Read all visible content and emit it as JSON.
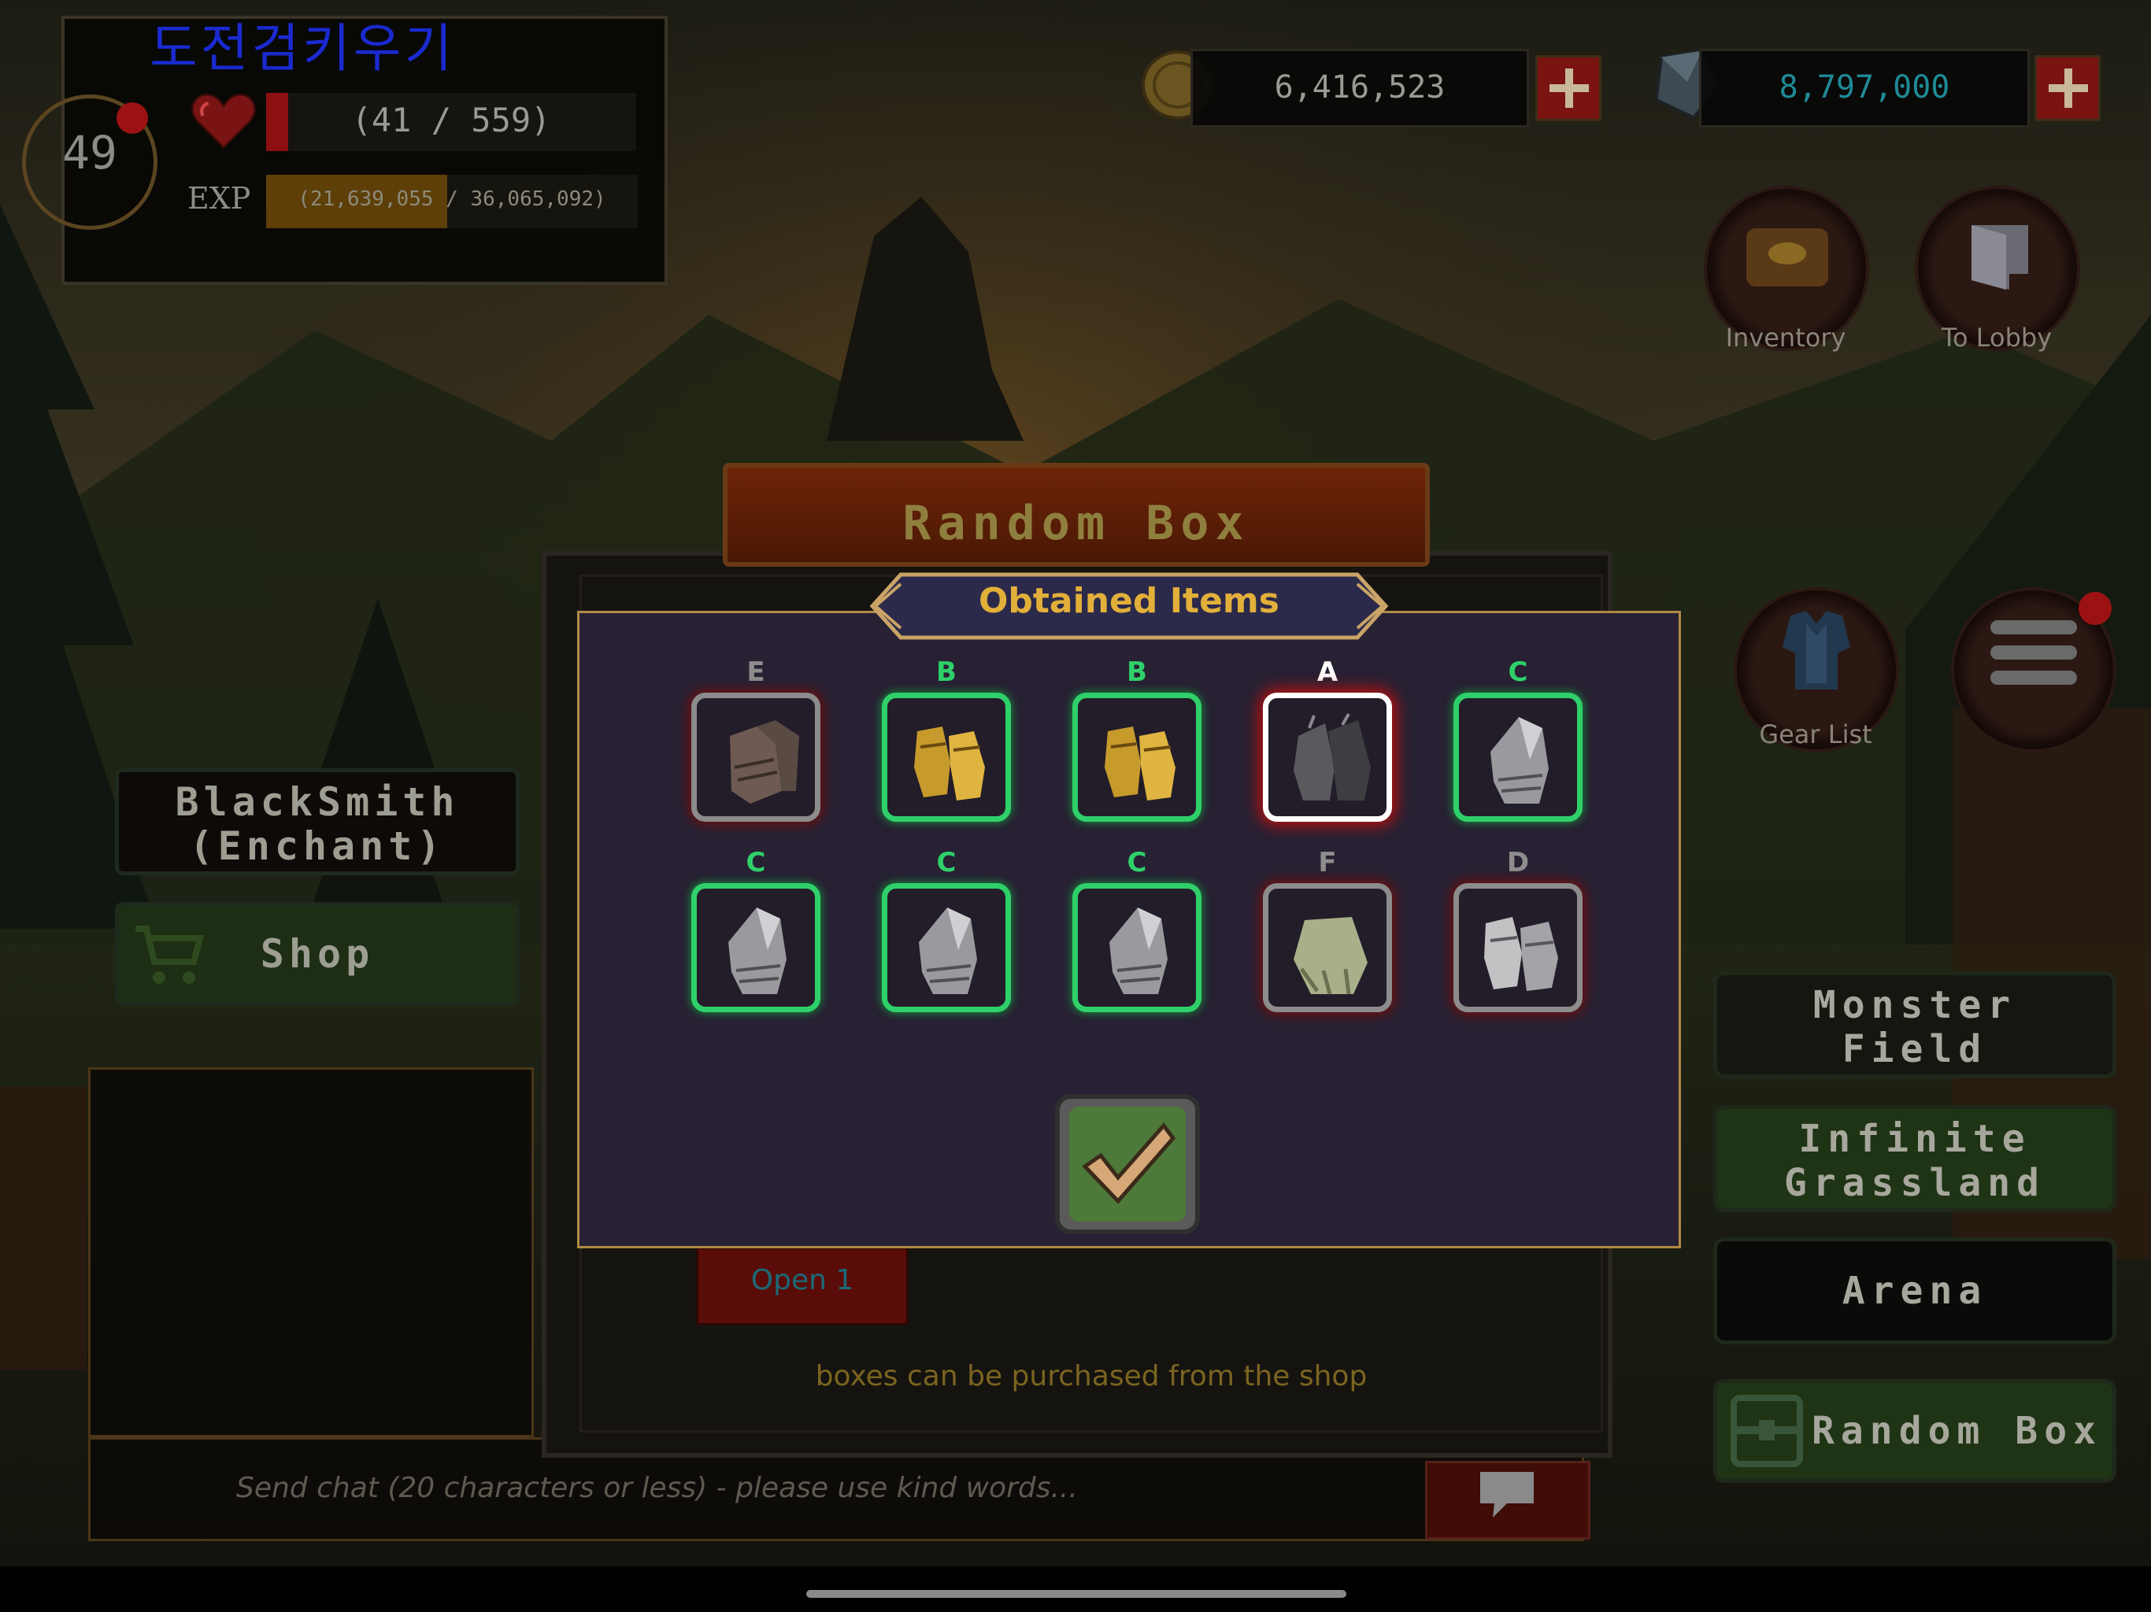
{
  "player": {
    "nickname": "도전검키우기",
    "level": "49",
    "hp_text": "(41 / 559)",
    "hp_fraction": 0.073,
    "exp_label": "EXP",
    "exp_text": "(21,639,055 / 36,065,092)",
    "exp_fraction": 0.6
  },
  "currency": {
    "gold": "6,416,523",
    "gems": "8,797,000",
    "gold_color": "#9a9a94",
    "gems_color": "#1f8a96"
  },
  "top_buttons": [
    {
      "label": "Inventory",
      "icon": "chest-icon"
    },
    {
      "label": "To Lobby",
      "icon": "door-icon"
    }
  ],
  "side_buttons": {
    "gear_list": "Gear List",
    "menu": "menu-icon"
  },
  "left_menu": {
    "blacksmith_line1": "BlackSmith",
    "blacksmith_line2": "(Enchant)",
    "shop": "Shop"
  },
  "right_menu": {
    "monster_field_1": "Monster",
    "monster_field_2": "Field",
    "infinite_1": "Infinite",
    "infinite_2": "Grassland",
    "arena": "Arena",
    "random_box": "Random Box"
  },
  "chat": {
    "placeholder": "Send chat (20 characters or less) - please use kind words..."
  },
  "random_box": {
    "title": "Random Box",
    "open_button": "Open 1",
    "hint": "boxes can be purchased from the shop"
  },
  "obtained": {
    "title": "Obtained Items",
    "grade_colors": {
      "E": "#8d8d8d",
      "B": "#2fd06a",
      "A": "#ffffff",
      "C": "#2fd06a",
      "F": "#8d8d8d",
      "D": "#8d8d8d"
    },
    "items": [
      {
        "grade": "E",
        "icon": "leather-gloves-icon"
      },
      {
        "grade": "B",
        "icon": "gold-gauntlets-icon"
      },
      {
        "grade": "B",
        "icon": "gold-gauntlets-icon"
      },
      {
        "grade": "A",
        "icon": "dark-gauntlets-icon"
      },
      {
        "grade": "C",
        "icon": "steel-gauntlet-icon"
      },
      {
        "grade": "C",
        "icon": "steel-gauntlet-icon"
      },
      {
        "grade": "C",
        "icon": "steel-gauntlet-icon"
      },
      {
        "grade": "C",
        "icon": "steel-gauntlet-icon"
      },
      {
        "grade": "F",
        "icon": "cloth-gloves-icon"
      },
      {
        "grade": "D",
        "icon": "iron-gauntlets-icon"
      }
    ]
  }
}
